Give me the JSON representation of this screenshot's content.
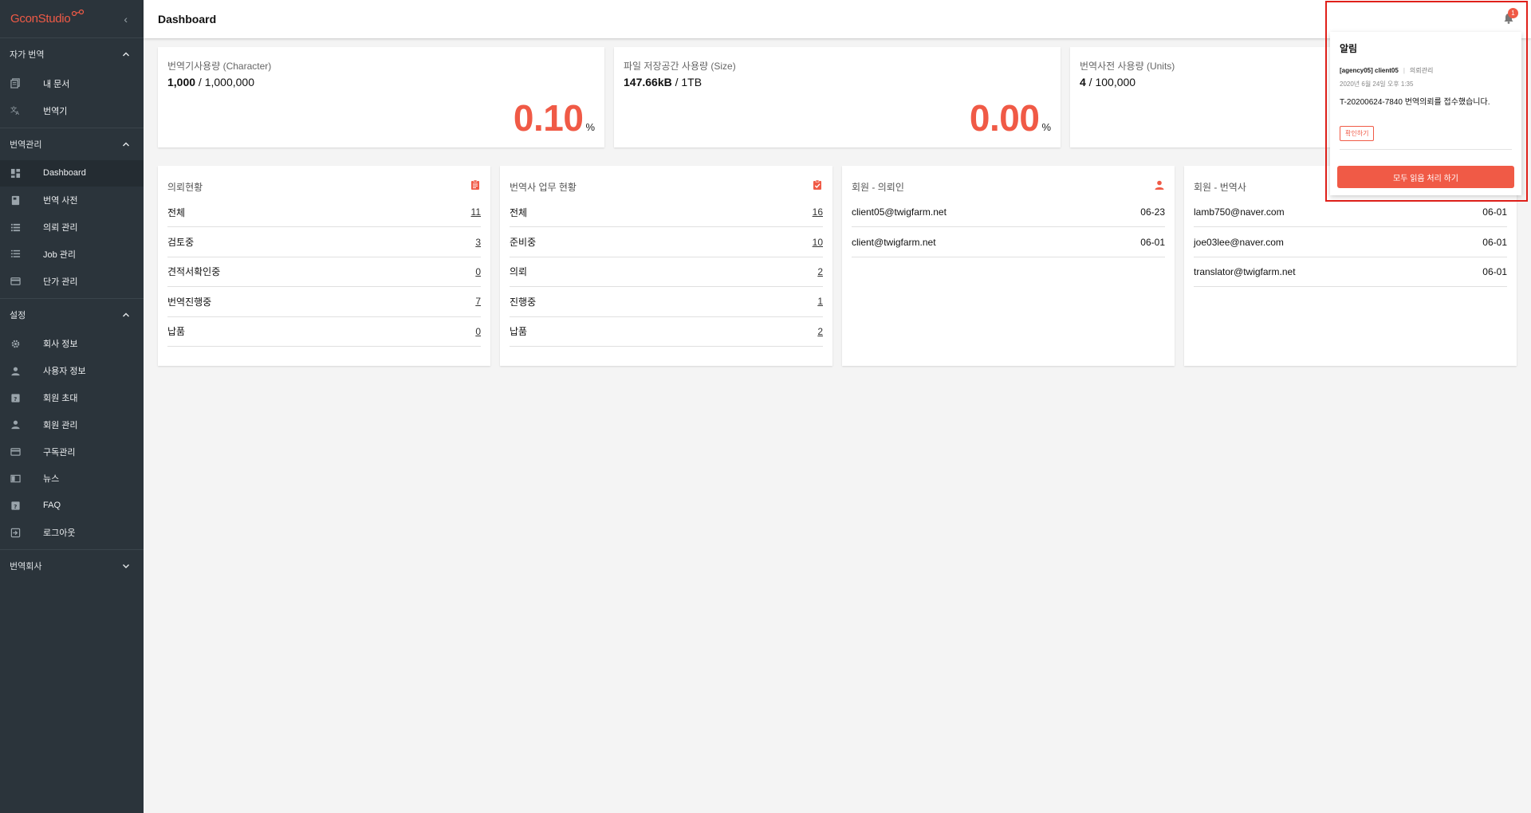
{
  "app": {
    "logo": "GconStudio",
    "title": "Dashboard"
  },
  "colors": {
    "accent": "#f05a46",
    "sidebar": "#2b343b",
    "highlight_outline": "#e0201a"
  },
  "sidebar": {
    "sections": [
      {
        "label": "자가 번역",
        "items": [
          {
            "label": "내 문서",
            "icon": "documents-icon"
          },
          {
            "label": "번역기",
            "icon": "translate-icon"
          }
        ]
      },
      {
        "label": "번역관리",
        "items": [
          {
            "label": "Dashboard",
            "icon": "dashboard-icon",
            "active": true
          },
          {
            "label": "번역 사전",
            "icon": "book-icon"
          },
          {
            "label": "의뢰 관리",
            "icon": "list-icon"
          },
          {
            "label": "Job 관리",
            "icon": "list-icon"
          },
          {
            "label": "단가 관리",
            "icon": "card-icon"
          }
        ]
      },
      {
        "label": "설정",
        "items": [
          {
            "label": "회사 정보",
            "icon": "gear-icon"
          },
          {
            "label": "사용자 정보",
            "icon": "person-icon"
          },
          {
            "label": "회원 초대",
            "icon": "help-icon"
          },
          {
            "label": "회원 관리",
            "icon": "person-icon"
          },
          {
            "label": "구독관리",
            "icon": "card-icon"
          },
          {
            "label": "뉴스",
            "icon": "news-icon"
          },
          {
            "label": "FAQ",
            "icon": "help-icon"
          },
          {
            "label": "로그아웃",
            "icon": "logout-icon"
          }
        ]
      }
    ],
    "company_section": "번역회사"
  },
  "stats": [
    {
      "label": "번역기사용량 (Character)",
      "used": "1,000",
      "total": " / 1,000,000",
      "percent": "0.10",
      "unit": "%"
    },
    {
      "label": "파일 저장공간 사용량 (Size)",
      "used": "147.66kB",
      "total": " / 1TB",
      "percent": "0.00",
      "unit": "%"
    },
    {
      "label": "번역사전 사용량 (Units)",
      "used": "4",
      "total": " / 100,000",
      "percent": "",
      "unit": ""
    }
  ],
  "request_status": {
    "title": "의뢰현황",
    "rows": [
      {
        "label": "전체",
        "count": "11"
      },
      {
        "label": "검토중",
        "count": "3"
      },
      {
        "label": "견적서확인중",
        "count": "0"
      },
      {
        "label": "번역진행중",
        "count": "7"
      },
      {
        "label": "납품",
        "count": "0"
      }
    ]
  },
  "translator_work": {
    "title": "번역사 업무 현황",
    "rows": [
      {
        "label": "전체",
        "count": "16"
      },
      {
        "label": "준비중",
        "count": "10"
      },
      {
        "label": "의뢰",
        "count": "2"
      },
      {
        "label": "진행중",
        "count": "1"
      },
      {
        "label": "납품",
        "count": "2"
      }
    ]
  },
  "members_client": {
    "title": "회원 - 의뢰인",
    "rows": [
      {
        "email": "client05@twigfarm.net",
        "date": "06-23"
      },
      {
        "email": "client@twigfarm.net",
        "date": "06-01"
      }
    ]
  },
  "members_translator": {
    "title": "회원 - 번역사",
    "rows": [
      {
        "email": "lamb750@naver.com",
        "date": "06-01"
      },
      {
        "email": "joe03lee@naver.com",
        "date": "06-01"
      },
      {
        "email": "translator@twigfarm.net",
        "date": "06-01"
      }
    ]
  },
  "notifications": {
    "badge_count": "1",
    "title": "알림",
    "item": {
      "sender": "[agency05] client05",
      "category": "의뢰관리",
      "date": "2020년 6월 24일 오후 1:35",
      "message": "T-20200624-7840 번역의뢰를 접수했습니다.",
      "confirm_label": "확인하기"
    },
    "read_all_label": "모두 읽음 처리 하기"
  }
}
